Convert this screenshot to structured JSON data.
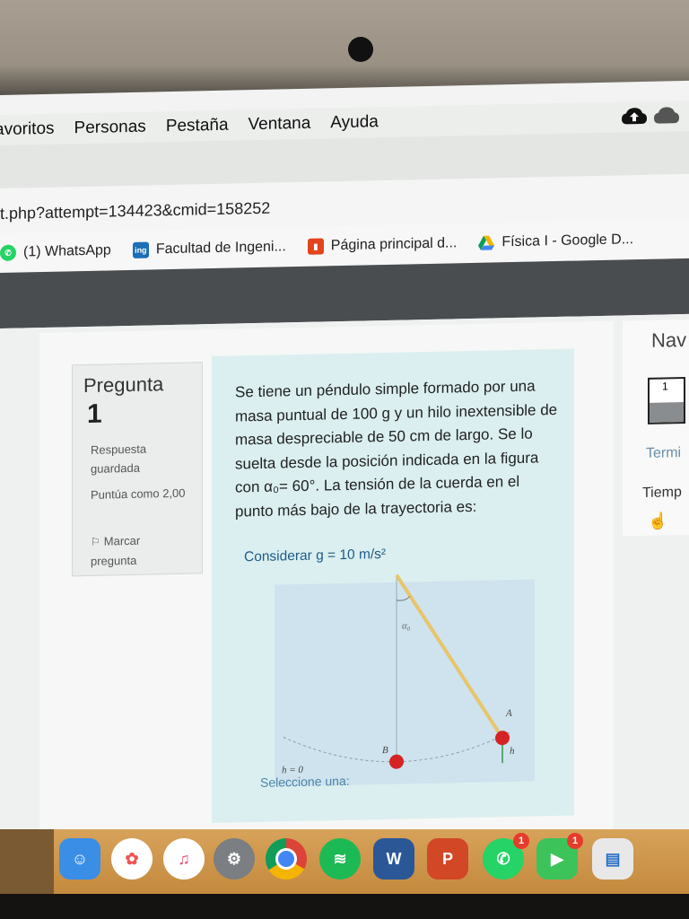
{
  "menubar": {
    "items": [
      "avoritos",
      "Personas",
      "Pestaña",
      "Ventana",
      "Ayuda"
    ]
  },
  "address": {
    "url": "t.php?attempt=134423&cmid=158252"
  },
  "bookmarks": [
    {
      "label": "(1) WhatsApp",
      "icon": "whatsapp-icon",
      "color": "#25d366"
    },
    {
      "label": "Facultad de Ingeni...",
      "icon": "ing",
      "color": "#1a6fb5"
    },
    {
      "label": "Página principal d...",
      "icon": "office-icon",
      "color": "#e2451e"
    },
    {
      "label": "Física I - Google D...",
      "icon": "google-drive-icon",
      "color": "#f4b400"
    }
  ],
  "info": {
    "title": "Pregunta",
    "number": "1",
    "status": "Respuesta guardada",
    "score": "Puntúa como 2,00",
    "flag": "Marcar pregunta"
  },
  "question": {
    "text": "Se tiene un péndulo simple formado por una masa puntual de 100 g y un hilo inextensible de masa despreciable de 50 cm de largo. Se lo suelta desde la posición indicada en la figura con α₀= 60°. La tensión de la cuerda en el punto más bajo de la trayectoria es:",
    "consider": "Considerar g = 10 m/s²",
    "select": "Seleccione una:"
  },
  "diagram": {
    "angle": "α₀",
    "pointA": "A",
    "pointB": "B",
    "height": "h",
    "zero": "h = 0"
  },
  "nav": {
    "title": "Nav",
    "box": "1",
    "finish": "Termi",
    "time": "Tiemp"
  },
  "dock": {
    "whatsapp_badge": "1",
    "facetime_badge": "1",
    "word_label": "W",
    "ppt_label": "P"
  }
}
